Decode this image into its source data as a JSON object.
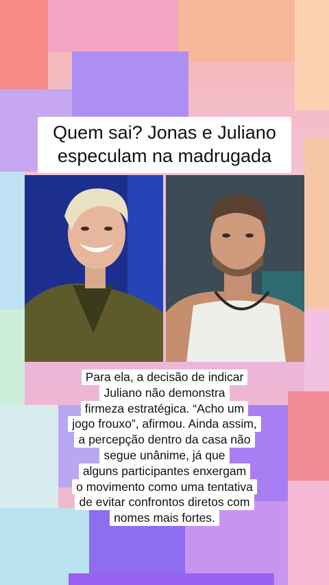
{
  "headline": {
    "line1": "Quem sai? Jonas e Juliano",
    "line2": "especulam na madrugada"
  },
  "caption": {
    "lines": [
      "Para ela, a decisão de indicar",
      "Juliano não demonstra",
      "firmeza estratégica. “Acho um",
      "jogo frouxo”, afirmou. Ainda assim,",
      "a percepção dentro da casa não",
      "segue unânime, já que",
      "alguns participantes enxergam",
      "o movimento como uma tentativa",
      "de evitar confrontos diretos com",
      "nomes mais fortes."
    ]
  },
  "photos": {
    "left": "laughing-blond-man-photo",
    "right": "bearded-man-tank-top-photo"
  },
  "colors": {
    "bg_pink": "#f0b8cf",
    "bg_peach": "#f7c6a6",
    "bg_violet": "#b6a6f2",
    "bg_purple": "#9a62f0",
    "bg_sky": "#bfe1f4",
    "bg_mint": "#cdeeda"
  }
}
